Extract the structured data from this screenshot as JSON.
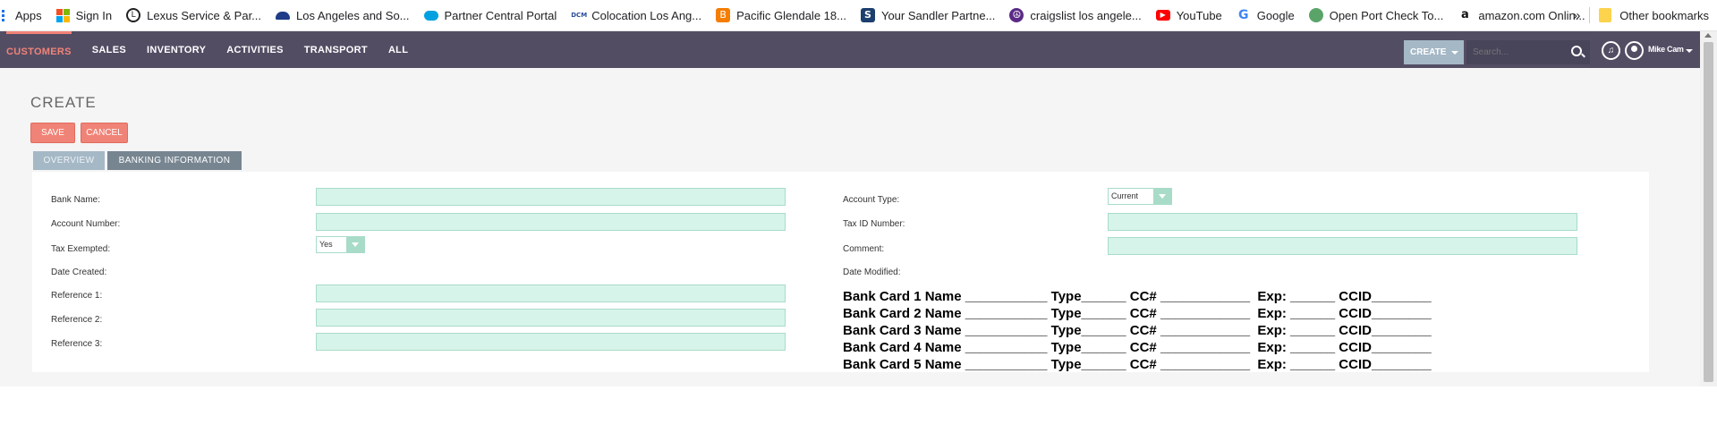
{
  "bookmarks": [
    {
      "label": "Apps",
      "icon": "apps-grid-icon",
      "color": "#1a73e8"
    },
    {
      "label": "Sign In",
      "icon": "microsoft-icon",
      "color": "#f25022"
    },
    {
      "label": "Lexus Service & Par...",
      "icon": "lexus-icon",
      "color": "#222222"
    },
    {
      "label": "Los Angeles and So...",
      "icon": "car-icon",
      "color": "#1f3c88"
    },
    {
      "label": "Partner Central Portal",
      "icon": "salesforce-cloud-icon",
      "color": "#00a1e0"
    },
    {
      "label": "Colocation Los Ang...",
      "icon": "dcm-icon",
      "color": "#2b4c9a"
    },
    {
      "label": "Pacific Glendale 18...",
      "icon": "blogger-icon",
      "color": "#f57d00"
    },
    {
      "label": "Your Sandler Partne...",
      "icon": "sandler-s-icon",
      "color": "#1c3f6e"
    },
    {
      "label": "craigslist los angele...",
      "icon": "peace-icon",
      "color": "#5b2a86"
    },
    {
      "label": "YouTube",
      "icon": "youtube-icon",
      "color": "#ff0000"
    },
    {
      "label": "Google",
      "icon": "google-icon",
      "color": "#4285f4"
    },
    {
      "label": "Open Port Check To...",
      "icon": "globe-icon",
      "color": "#5aa469"
    },
    {
      "label": "amazon.com Onlin...",
      "icon": "amazon-icon",
      "color": "#111111"
    }
  ],
  "bookmarks_more": "»",
  "other_bookmarks": "Other bookmarks",
  "nav": {
    "tabs": [
      "CUSTOMERS",
      "SALES",
      "INVENTORY",
      "ACTIVITIES",
      "TRANSPORT",
      "ALL"
    ],
    "active": "CUSTOMERS",
    "create_label": "CREATE",
    "search_placeholder": "Search...",
    "user_name": "Mike Cam"
  },
  "page": {
    "title": "CREATE",
    "save_label": "SAVE",
    "cancel_label": "CANCEL",
    "tabs": [
      "OVERVIEW",
      "BANKING INFORMATION"
    ],
    "active_tab": "BANKING INFORMATION"
  },
  "form": {
    "left": {
      "bank_name": "Bank Name:",
      "account_number": "Account Number:",
      "tax_exempted": "Tax Exempted:",
      "tax_exempted_value": "Yes",
      "date_created": "Date Created:",
      "reference1": "Reference 1:",
      "reference2": "Reference 2:",
      "reference3": "Reference 3:"
    },
    "right": {
      "account_type": "Account Type:",
      "account_type_value": "Current",
      "tax_id": "Tax ID Number:",
      "comment": "Comment:",
      "date_modified": "Date Modified:"
    }
  },
  "bank_cards": [
    "Bank Card 1 Name ___________ Type______ CC# ____________  Exp: ______ CCID________",
    "Bank Card 2 Name ___________ Type______ CC# ____________  Exp: ______ CCID________",
    "Bank Card 3 Name ___________ Type______ CC# ____________  Exp: ______ CCID________",
    "Bank Card 4 Name ___________ Type______ CC# ____________  Exp: ______ CCID________",
    "Bank Card 5 Name ___________ Type______ CC# ____________  Exp: ______ CCID________"
  ],
  "colors": {
    "nav_bg": "#534d64",
    "accent": "#f08377",
    "field_bg": "#d7f4ea",
    "tab_active": "#778591",
    "tab_inactive": "#a5b8c6"
  }
}
